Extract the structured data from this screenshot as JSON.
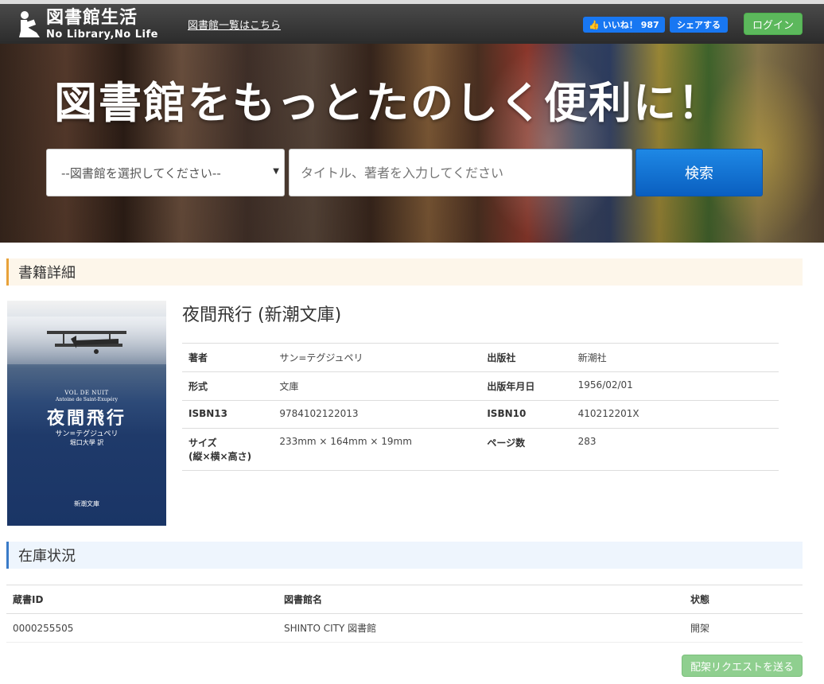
{
  "header": {
    "logo_title": "図書館生活",
    "logo_subtitle": "No Library,No Life",
    "library_list_link": "図書館一覧はこちら",
    "fb_like_label": "いいね！",
    "fb_like_count": "987",
    "fb_share_label": "シェアする",
    "login_label": "ログイン"
  },
  "hero": {
    "title": "図書館をもっとたのしく便利に！",
    "library_select_value": "--図書館を選択してください--",
    "search_placeholder": "タイトル、著者を入力してください",
    "search_button": "検索"
  },
  "book_section": {
    "heading": "書籍詳細",
    "title": "夜間飛行 (新潮文庫)",
    "cover": {
      "title_fr": "VOL DE NUIT",
      "author_fr": "Antoine de Saint-Exupéry",
      "title_jp": "夜間飛行",
      "author_jp": "サン=テグジュペリ",
      "translator": "堀口大學 訳",
      "publisher": "新潮文庫"
    },
    "details": [
      {
        "label": "著者",
        "value": "サン=テグジュペリ",
        "label2": "出版社",
        "value2": "新潮社"
      },
      {
        "label": "形式",
        "value": "文庫",
        "label2": "出版年月日",
        "value2": "1956/02/01"
      },
      {
        "label": "ISBN13",
        "value": "9784102122013",
        "label2": "ISBN10",
        "value2": "410212201X"
      },
      {
        "label": "サイズ",
        "label_sub": "(縦×横×高さ)",
        "value": "233mm × 164mm × 19mm",
        "label2": "ページ数",
        "value2": "283"
      }
    ]
  },
  "stock_section": {
    "heading": "在庫状況",
    "columns": [
      "蔵書ID",
      "図書館名",
      "状態"
    ],
    "rows": [
      {
        "id": "0000255505",
        "library": "SHINTO CITY 図書館",
        "status": "開架"
      }
    ],
    "request_button": "配架リクエストを送る"
  }
}
